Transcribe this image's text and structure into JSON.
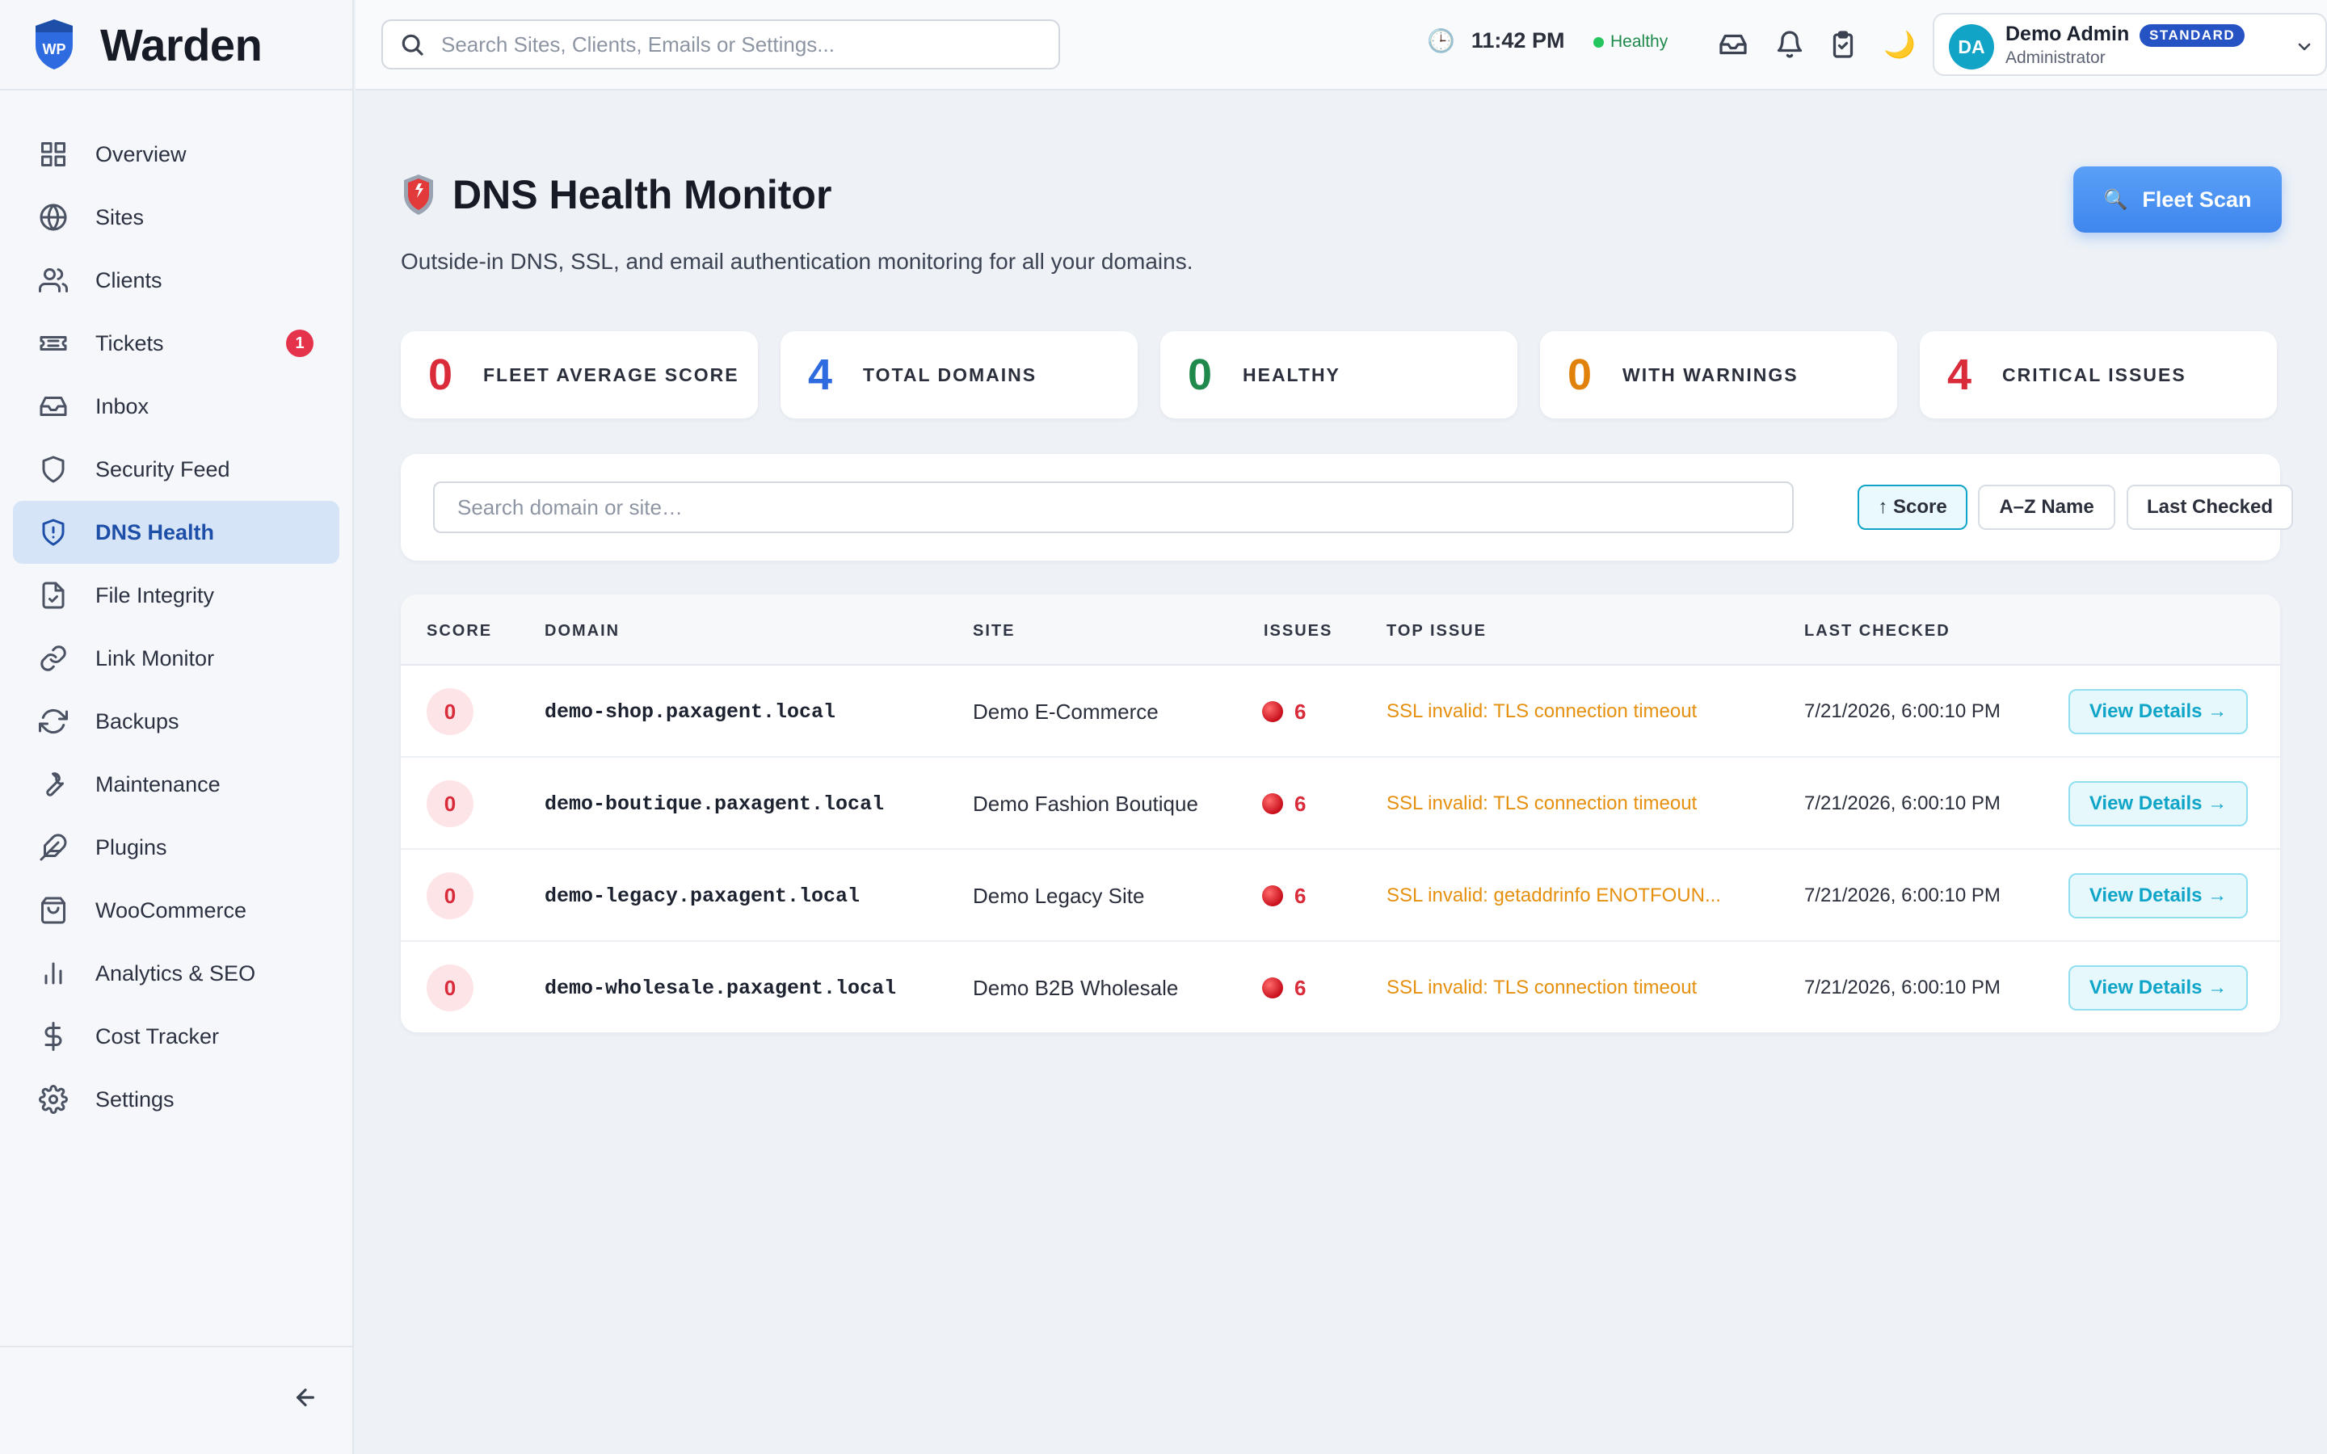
{
  "app": {
    "name": "Warden",
    "logo_text": "WP"
  },
  "sidebar": {
    "items": [
      {
        "label": "Overview",
        "icon": "grid-icon"
      },
      {
        "label": "Sites",
        "icon": "globe-icon"
      },
      {
        "label": "Clients",
        "icon": "users-icon"
      },
      {
        "label": "Tickets",
        "icon": "ticket-icon",
        "badge": "1"
      },
      {
        "label": "Inbox",
        "icon": "inbox-icon"
      },
      {
        "label": "Security Feed",
        "icon": "shield-icon"
      },
      {
        "label": "DNS Health",
        "icon": "shield-alert-icon",
        "active": true
      },
      {
        "label": "File Integrity",
        "icon": "file-check-icon"
      },
      {
        "label": "Link Monitor",
        "icon": "link-icon"
      },
      {
        "label": "Backups",
        "icon": "refresh-icon"
      },
      {
        "label": "Maintenance",
        "icon": "wrench-icon"
      },
      {
        "label": "Plugins",
        "icon": "feather-icon"
      },
      {
        "label": "WooCommerce",
        "icon": "shopping-bag-icon"
      },
      {
        "label": "Analytics & SEO",
        "icon": "bar-chart-icon"
      },
      {
        "label": "Cost Tracker",
        "icon": "dollar-icon"
      },
      {
        "label": "Settings",
        "icon": "gear-icon"
      }
    ]
  },
  "topbar": {
    "search_placeholder": "Search Sites, Clients, Emails or Settings...",
    "time": "11:42 PM",
    "health": "Healthy",
    "user": {
      "initials": "DA",
      "name": "Demo Admin",
      "role": "Administrator",
      "plan": "STANDARD"
    }
  },
  "page": {
    "title": "DNS Health Monitor",
    "subtitle": "Outside-in DNS, SSL, and email authentication monitoring for all your domains.",
    "scan_button": "Fleet Scan"
  },
  "stats": [
    {
      "value": "0",
      "label": "FLEET AVERAGE SCORE",
      "color": "#d92b3a"
    },
    {
      "value": "4",
      "label": "TOTAL DOMAINS",
      "color": "#2f6be0"
    },
    {
      "value": "0",
      "label": "HEALTHY",
      "color": "#1f8a4c"
    },
    {
      "value": "0",
      "label": "WITH WARNINGS",
      "color": "#e0820c"
    },
    {
      "value": "4",
      "label": "CRITICAL ISSUES",
      "color": "#d92b3a"
    }
  ],
  "filter": {
    "placeholder": "Search domain or site…",
    "sort_score": "↑ Score",
    "sort_name": "A–Z Name",
    "sort_checked": "Last Checked"
  },
  "table": {
    "headers": {
      "score": "SCORE",
      "domain": "DOMAIN",
      "site": "SITE",
      "issues": "ISSUES",
      "top_issue": "TOP ISSUE",
      "last_checked": "LAST CHECKED"
    },
    "view_label": "View Details →",
    "rows": [
      {
        "score": "0",
        "domain": "demo-shop.paxagent.local",
        "site": "Demo E-Commerce",
        "issues": "6",
        "top_issue": "SSL invalid: TLS connection timeout",
        "last_checked": "7/21/2026, 6:00:10 PM"
      },
      {
        "score": "0",
        "domain": "demo-boutique.paxagent.local",
        "site": "Demo Fashion Boutique",
        "issues": "6",
        "top_issue": "SSL invalid: TLS connection timeout",
        "last_checked": "7/21/2026, 6:00:10 PM"
      },
      {
        "score": "0",
        "domain": "demo-legacy.paxagent.local",
        "site": "Demo Legacy Site",
        "issues": "6",
        "top_issue": "SSL invalid: getaddrinfo ENOTFOUN...",
        "last_checked": "7/21/2026, 6:00:10 PM"
      },
      {
        "score": "0",
        "domain": "demo-wholesale.paxagent.local",
        "site": "Demo B2B Wholesale",
        "issues": "6",
        "top_issue": "SSL invalid: TLS connection timeout",
        "last_checked": "7/21/2026, 6:00:10 PM"
      }
    ]
  }
}
